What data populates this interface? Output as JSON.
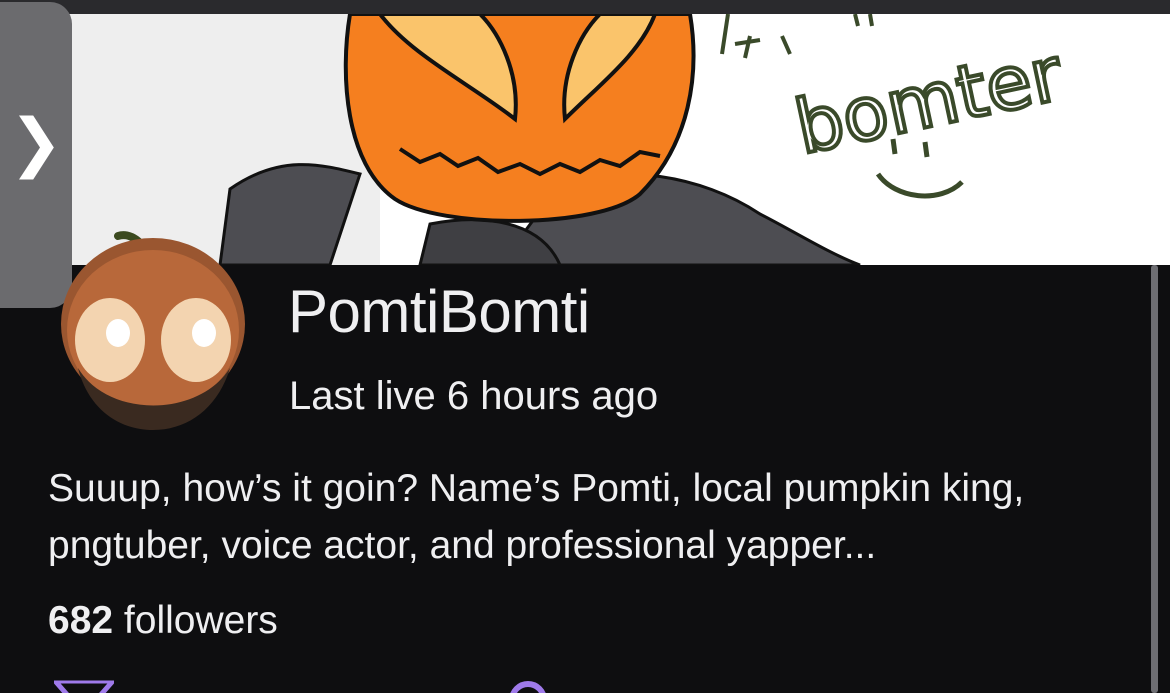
{
  "app": {
    "side_tab": {
      "icon": "chevron-right-icon",
      "glyph": "❯"
    }
  },
  "banner": {
    "description_icon": "pumpkin-king-drawing",
    "handwriting": "bomter"
  },
  "profile": {
    "channel_name": "PomtiBomti",
    "last_live": "Last live 6 hours ago",
    "bio": "Suuup, how’s it goin? Name’s Pomti, local pumpkin king, pngtuber, voice actor, and professional yapper...",
    "followers_count": "682",
    "followers_label": " followers"
  },
  "social_links": [
    {
      "icon": "x-logo-icon"
    },
    {
      "icon": "link-icon"
    }
  ],
  "colors": {
    "background": "#0e0e10",
    "text": "#efeff1",
    "accent_purple": "#9f7aea",
    "pumpkin_orange": "#f57f1f"
  }
}
